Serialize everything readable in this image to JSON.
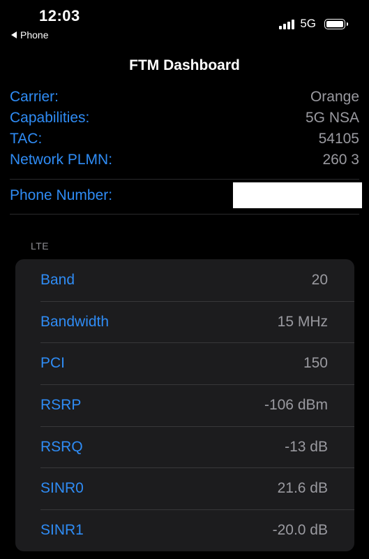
{
  "status_bar": {
    "time": "12:03",
    "back_label": "Phone",
    "network_type": "5G"
  },
  "page": {
    "title": "FTM Dashboard"
  },
  "info": [
    {
      "label": "Carrier:",
      "value": "Orange"
    },
    {
      "label": "Capabilities:",
      "value": "5G NSA"
    },
    {
      "label": "TAC:",
      "value": "54105"
    },
    {
      "label": "Network PLMN:",
      "value": "260 3"
    }
  ],
  "phone_number": {
    "label": "Phone Number:"
  },
  "lte": {
    "header": "LTE",
    "rows": [
      {
        "label": "Band",
        "value": "20"
      },
      {
        "label": "Bandwidth",
        "value": "15 MHz"
      },
      {
        "label": "PCI",
        "value": "150"
      },
      {
        "label": "RSRP",
        "value": "-106 dBm"
      },
      {
        "label": "RSRQ",
        "value": "-13 dB"
      },
      {
        "label": "SINR0",
        "value": "21.6 dB"
      },
      {
        "label": "SINR1",
        "value": "-20.0 dB"
      }
    ]
  },
  "colors": {
    "accent_blue": "#2f8cf5",
    "value_gray": "#9a9aa0",
    "card_background": "#1c1c1e",
    "background": "#000000"
  },
  "icons": {
    "back": "back-arrow-icon",
    "signal": "cellular-signal-icon",
    "battery": "battery-icon"
  }
}
